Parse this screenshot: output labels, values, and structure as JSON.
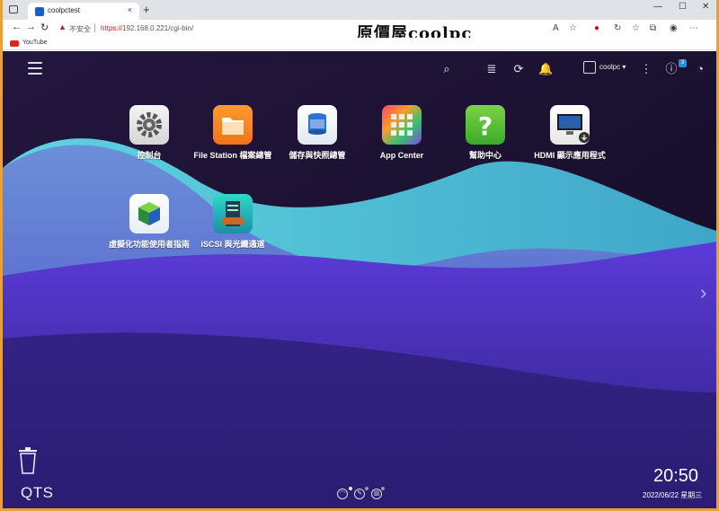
{
  "browser": {
    "tab_title": "coolpctest",
    "tab_close": "×",
    "new_tab": "+",
    "win_min": "—",
    "win_max": "☐",
    "win_close": "✕",
    "not_secure": "不安全",
    "url_protocol": "https://",
    "url_rest": "192.168.0.221/cgi-bin/",
    "brand": "原價屋coolpc",
    "bookmark_youtube": "YouTube"
  },
  "topbar": {
    "username": "coolpc ▾",
    "notification_count": "3"
  },
  "apps": [
    {
      "label": "控制台"
    },
    {
      "label": "File Station 檔案總管"
    },
    {
      "label": "儲存與快照總管"
    },
    {
      "label": "App Center"
    },
    {
      "label": "幫助中心"
    },
    {
      "label": "HDMI 顯示應用程式"
    },
    {
      "label": "虛擬化功能使用者指南"
    },
    {
      "label": "iSCSI 與光纖通道"
    }
  ],
  "footer": {
    "logo": "QTS",
    "time": "20:50",
    "date": "2022/06/22 星期三"
  },
  "colors": {
    "accent": "#2a8de0",
    "teal_wave": "#4fd8d8",
    "purple_wave": "#5a3fd0"
  }
}
